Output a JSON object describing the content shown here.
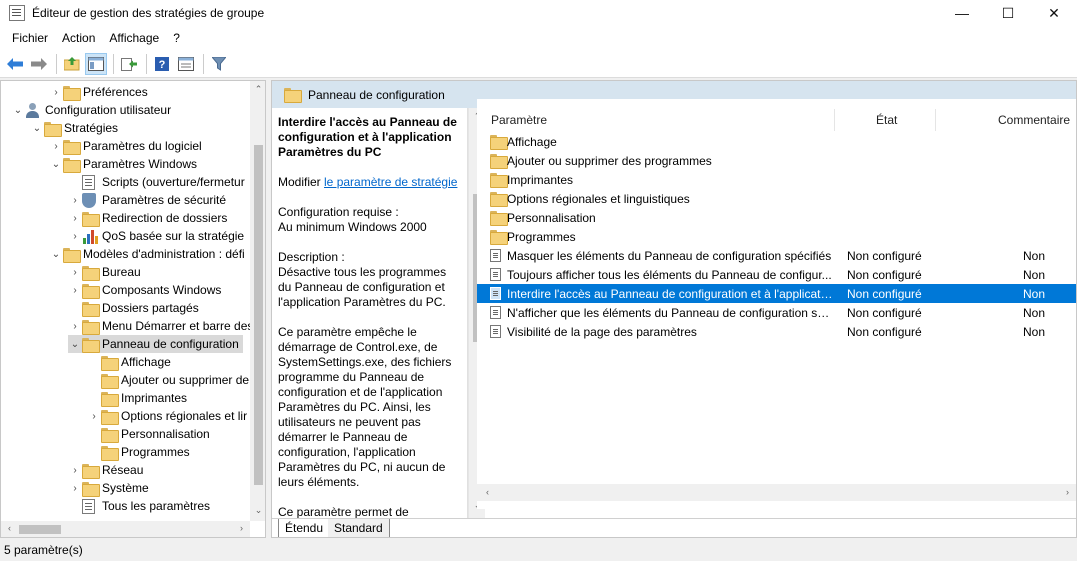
{
  "window": {
    "title": "Éditeur de gestion des stratégies de groupe",
    "minimize": "—",
    "maximize": "☐",
    "close": "✕"
  },
  "menu": [
    "Fichier",
    "Action",
    "Affichage",
    "?"
  ],
  "toolbar": {
    "icons": [
      "back-arrow-icon",
      "forward-arrow-icon",
      "up-folder-icon",
      "show-tree-icon",
      "export-icon",
      "help-icon",
      "view-icon",
      "filter-icon"
    ]
  },
  "tree": [
    {
      "label": "Préférences",
      "depth": 3,
      "expander": "›",
      "icon": "folder"
    },
    {
      "label": "Configuration utilisateur",
      "depth": 1,
      "expander": "⌄",
      "icon": "user"
    },
    {
      "label": "Stratégies",
      "depth": 2,
      "expander": "⌄",
      "icon": "folder"
    },
    {
      "label": "Paramètres du logiciel",
      "depth": 3,
      "expander": "›",
      "icon": "folder"
    },
    {
      "label": "Paramètres Windows",
      "depth": 3,
      "expander": "⌄",
      "icon": "folder"
    },
    {
      "label": "Scripts (ouverture/fermetur",
      "depth": 4,
      "expander": "",
      "icon": "doc"
    },
    {
      "label": "Paramètres de sécurité",
      "depth": 4,
      "expander": "›",
      "icon": "shield"
    },
    {
      "label": "Redirection de dossiers",
      "depth": 4,
      "expander": "›",
      "icon": "folder"
    },
    {
      "label": "QoS basée sur la stratégie",
      "depth": 4,
      "expander": "›",
      "icon": "chart"
    },
    {
      "label": "Modèles d'administration : défi",
      "depth": 3,
      "expander": "⌄",
      "icon": "folder"
    },
    {
      "label": "Bureau",
      "depth": 4,
      "expander": "›",
      "icon": "folder"
    },
    {
      "label": "Composants Windows",
      "depth": 4,
      "expander": "›",
      "icon": "folder"
    },
    {
      "label": "Dossiers partagés",
      "depth": 4,
      "expander": "",
      "icon": "folder"
    },
    {
      "label": "Menu Démarrer et barre des",
      "depth": 4,
      "expander": "›",
      "icon": "folder"
    },
    {
      "label": "Panneau de configuration",
      "depth": 4,
      "expander": "⌄",
      "icon": "folder",
      "selected": true
    },
    {
      "label": "Affichage",
      "depth": 5,
      "expander": "",
      "icon": "folder"
    },
    {
      "label": "Ajouter ou supprimer de",
      "depth": 5,
      "expander": "",
      "icon": "folder"
    },
    {
      "label": "Imprimantes",
      "depth": 5,
      "expander": "",
      "icon": "folder"
    },
    {
      "label": "Options régionales et lir",
      "depth": 5,
      "expander": "›",
      "icon": "folder"
    },
    {
      "label": "Personnalisation",
      "depth": 5,
      "expander": "",
      "icon": "folder"
    },
    {
      "label": "Programmes",
      "depth": 5,
      "expander": "",
      "icon": "folder"
    },
    {
      "label": "Réseau",
      "depth": 4,
      "expander": "›",
      "icon": "folder"
    },
    {
      "label": "Système",
      "depth": 4,
      "expander": "›",
      "icon": "folder"
    },
    {
      "label": "Tous les paramètres",
      "depth": 4,
      "expander": "",
      "icon": "doc"
    }
  ],
  "panel": {
    "header": "Panneau de configuration"
  },
  "description": {
    "title": "Interdire l'accès au Panneau de configuration et à l'application Paramètres du PC",
    "modify_prefix": "Modifier ",
    "modify_link": "le paramètre de stratégie",
    "requirements_label": "Configuration requise :",
    "requirements_value": "Au minimum Windows 2000",
    "description_label": "Description :",
    "description_text": "Désactive tous les programmes du Panneau de configuration et l'application Paramètres du PC.",
    "paragraph2": "Ce paramètre empêche le démarrage de Control.exe, de SystemSettings.exe, des fichiers programme du Panneau de configuration et de l'application Paramètres du PC. Ainsi, les utilisateurs ne peuvent pas démarrer le Panneau de configuration, l'application Paramètres du PC, ni aucun de leurs éléments.",
    "paragraph3": "Ce paramètre permet de"
  },
  "list": {
    "columns": [
      "Paramètre",
      "État",
      "Commentaire"
    ],
    "rows": [
      {
        "name": "Affichage",
        "type": "folder",
        "state": "",
        "comment": ""
      },
      {
        "name": "Ajouter ou supprimer des programmes",
        "type": "folder",
        "state": "",
        "comment": ""
      },
      {
        "name": "Imprimantes",
        "type": "folder",
        "state": "",
        "comment": ""
      },
      {
        "name": "Options régionales et linguistiques",
        "type": "folder",
        "state": "",
        "comment": ""
      },
      {
        "name": "Personnalisation",
        "type": "folder",
        "state": "",
        "comment": ""
      },
      {
        "name": "Programmes",
        "type": "folder",
        "state": "",
        "comment": ""
      },
      {
        "name": "Masquer les éléments du Panneau de configuration spécifiés",
        "type": "setting",
        "state": "Non configuré",
        "comment": "Non"
      },
      {
        "name": "Toujours afficher tous les éléments du Panneau de configur...",
        "type": "setting",
        "state": "Non configuré",
        "comment": "Non"
      },
      {
        "name": "Interdire l'accès au Panneau de configuration et à l'applicati...",
        "type": "setting",
        "state": "Non configuré",
        "comment": "Non",
        "selected": true
      },
      {
        "name": "N'afficher que les éléments du Panneau de configuration sp...",
        "type": "setting",
        "state": "Non configuré",
        "comment": "Non"
      },
      {
        "name": "Visibilité de la page des paramètres",
        "type": "setting",
        "state": "Non configuré",
        "comment": "Non"
      }
    ]
  },
  "tabs": [
    "Étendu",
    "Standard"
  ],
  "status": "5 paramètre(s)"
}
